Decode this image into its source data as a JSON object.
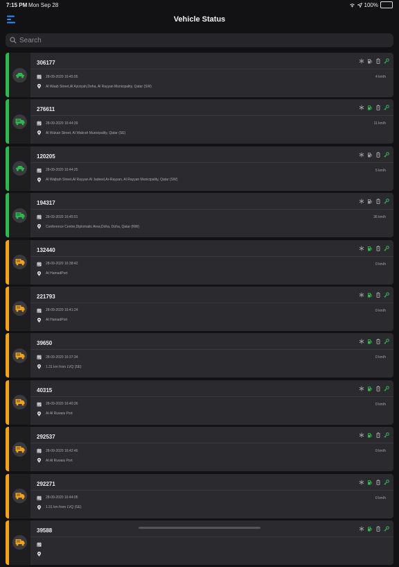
{
  "status_bar": {
    "time": "7:15 PM",
    "date": "Mon Sep 28",
    "battery": "100%"
  },
  "header": {
    "title": "Vehicle Status"
  },
  "search": {
    "placeholder": "Search"
  },
  "colors": {
    "moving": "#2db84d",
    "idle": "#f3a21b",
    "accent_blue": "#2f8dff",
    "card": "#2b2b2f"
  },
  "vehicles": [
    {
      "id": "306177",
      "status": "moving",
      "vehicle_icon": "car-icon",
      "datetime": "28-09-2020 16:45:05",
      "speed": "4 km/h",
      "location": "Al Waab Street,Al Aziziyah,Doha, Al Rayyan Municipality, Qatar (SW)",
      "fuel_on": false
    },
    {
      "id": "276611",
      "status": "moving",
      "vehicle_icon": "truck-icon",
      "datetime": "28-09-2020 16:44:39",
      "speed": "11 km/h",
      "location": "Al Wukair Street, Al Wakrah Municipality, Qatar (SE)",
      "fuel_on": true
    },
    {
      "id": "120205",
      "status": "moving",
      "vehicle_icon": "car-icon",
      "datetime": "28-09-2020 16:44:25",
      "speed": "5 km/h",
      "location": "Al Wajbah Street,Al Rayyan Al Jadeed,Ar-Rayyan, Al Rayyan Municipality, Qatar (SW)",
      "fuel_on": false
    },
    {
      "id": "194317",
      "status": "moving",
      "vehicle_icon": "truck-icon",
      "datetime": "28-09-2020 16:45:01",
      "speed": "36 km/h",
      "location": "Conference Centre,Diplomatic Area,Doha, Doha, Qatar (NW)",
      "fuel_on": false
    },
    {
      "id": "132440",
      "status": "idle",
      "vehicle_icon": "truck-icon",
      "datetime": "28-09-2020 16:38:42",
      "speed": "0 km/h",
      "location": "At HamadPort",
      "fuel_on": true
    },
    {
      "id": "221793",
      "status": "idle",
      "vehicle_icon": "truck-icon",
      "datetime": "28-09-2020 16:41:24",
      "speed": "0 km/h",
      "location": "At HamadPort",
      "fuel_on": true
    },
    {
      "id": "39650",
      "status": "idle",
      "vehicle_icon": "truck-icon",
      "datetime": "28-09-2020 16:37:34",
      "speed": "0 km/h",
      "location": "1.31 km from LVQ (SE)",
      "fuel_on": true
    },
    {
      "id": "40315",
      "status": "idle",
      "vehicle_icon": "truck-icon",
      "datetime": "28-09-2020 16:40:26",
      "speed": "0 km/h",
      "location": "At Al Ruwais Port",
      "fuel_on": true
    },
    {
      "id": "292537",
      "status": "idle",
      "vehicle_icon": "truck-icon",
      "datetime": "28-09-2020 16:42:46",
      "speed": "0 km/h",
      "location": "At Al Ruwais Port",
      "fuel_on": true
    },
    {
      "id": "292271",
      "status": "idle",
      "vehicle_icon": "truck-icon",
      "datetime": "28-09-2020 16:44:05",
      "speed": "0 km/h",
      "location": "1.31 km from LVQ (SE)",
      "fuel_on": true
    },
    {
      "id": "39588",
      "status": "idle",
      "vehicle_icon": "truck-icon",
      "datetime": "",
      "speed": "",
      "location": "",
      "fuel_on": true
    }
  ]
}
